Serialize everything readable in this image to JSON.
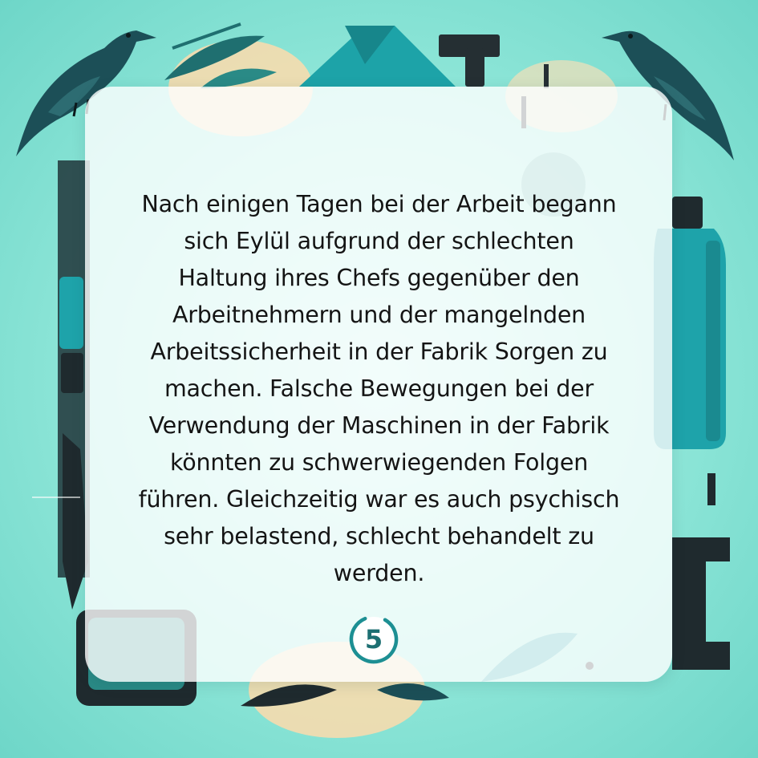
{
  "story_card": {
    "text": "Nach einigen Tagen bei der Arbeit begann\nsich Eylül aufgrund der schlechten\nHaltung ihres Chefs gegenüber den\nArbeitnehmern und der mangelnden\nArbeitssicherheit in der Fabrik Sorgen zu\nmachen. Falsche Bewegungen bei der\nVerwendung der Maschinen in der Fabrik\nkönnten zu schwerwiegenden Folgen\nführen. Gleichzeitig war es auch psychisch\nsehr belastend, schlecht behandelt zu\nwerden.",
    "page_number": "5"
  },
  "illustration": {
    "icons": [
      "crow-icon",
      "crow-icon",
      "bottle-icon",
      "gear-icon",
      "leaf-icon",
      "tool-icon",
      "block-icon"
    ]
  },
  "colors": {
    "background": "#8ee6d8",
    "accent_teal": "#1d9aa0",
    "dark_teal": "#1c4f57",
    "ink": "#1f2a2e",
    "cream": "#f6dcae",
    "card": "#ffffff",
    "badge_ring": "#1d8f93"
  }
}
